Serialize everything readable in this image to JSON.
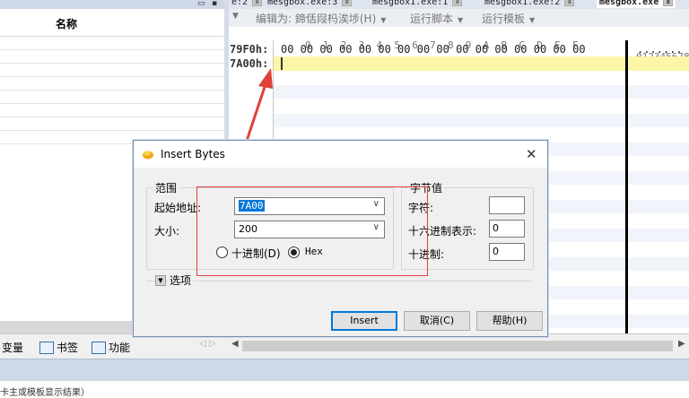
{
  "left_panel": {
    "header_name": "名称",
    "rows": 11
  },
  "bottom_tabs": [
    {
      "label": "变量",
      "icon": "variables-icon"
    },
    {
      "label": "书签",
      "icon": "bookmark-icon"
    },
    {
      "label": "功能",
      "icon": "function-icon"
    }
  ],
  "status_text": "卡主或模板显示结果）",
  "doc_tabs": [
    {
      "label": "e:2"
    },
    {
      "label": "mesgbox.exe:3"
    },
    {
      "label": "mesgbox1.exe:1"
    },
    {
      "label": "mesgbox1.exe:2"
    },
    {
      "label": "mesgbox.exe",
      "active": true
    }
  ],
  "hex_toolbar": {
    "edit_as": "编辑为: 鍗佸叚杩涘埗(H)",
    "run_script": "运行脚本",
    "run_template": "运行模板"
  },
  "hex_view": {
    "column_header": "0  1  2  3  4  5  6  7  8  9  A  B  C  D  E  F",
    "ascii_header": "0123456789",
    "rows": [
      {
        "address": "79F0h:",
        "bytes": "00 00 00 00 00 00 00 00 00 00 00 00 00 00 00 00",
        "ascii": "......."
      },
      {
        "address": "7A00h:",
        "bytes": "",
        "ascii": ""
      }
    ]
  },
  "dialog": {
    "title": "Insert Bytes",
    "range_group": "范围",
    "start_label": "起始地址:",
    "start_value": "7A00",
    "size_label": "大小:",
    "size_value": "200",
    "radio_decimal": "十进制(D)",
    "radio_hex": "Hex",
    "radio_selected": "Hex",
    "byte_group": "字节值",
    "char_label": "字符:",
    "char_value": "",
    "hex_label": "十六进制表示:",
    "hex_value": "0",
    "dec_label": "十进制:",
    "dec_value": "0",
    "options_label": "选项",
    "insert_button": "Insert",
    "cancel_button": "取消(C)",
    "help_button": "帮助(H)"
  },
  "colors": {
    "highlight_row": "#fbf7a6",
    "annotation_red": "#e0403a",
    "title_bar": "#ffffff",
    "status_bar": "#cfd8e6"
  }
}
